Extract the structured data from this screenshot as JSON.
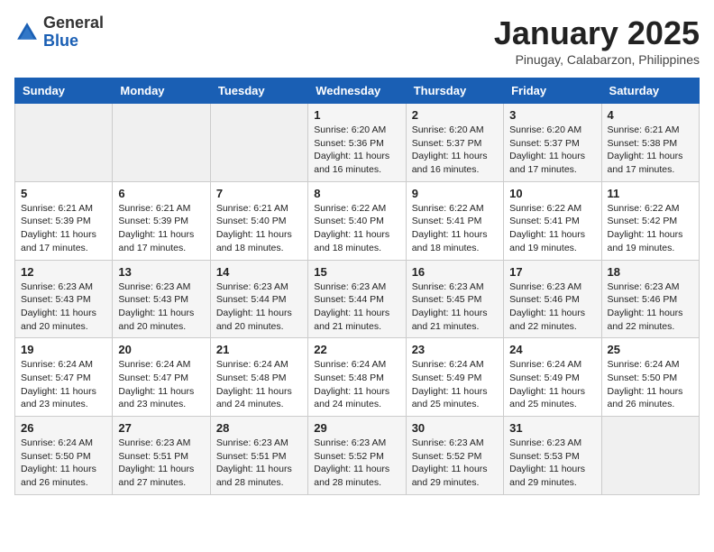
{
  "header": {
    "logo_general": "General",
    "logo_blue": "Blue",
    "month_title": "January 2025",
    "location": "Pinugay, Calabarzon, Philippines"
  },
  "weekdays": [
    "Sunday",
    "Monday",
    "Tuesday",
    "Wednesday",
    "Thursday",
    "Friday",
    "Saturday"
  ],
  "weeks": [
    [
      {
        "day": "",
        "sunrise": "",
        "sunset": "",
        "daylight": ""
      },
      {
        "day": "",
        "sunrise": "",
        "sunset": "",
        "daylight": ""
      },
      {
        "day": "",
        "sunrise": "",
        "sunset": "",
        "daylight": ""
      },
      {
        "day": "1",
        "sunrise": "Sunrise: 6:20 AM",
        "sunset": "Sunset: 5:36 PM",
        "daylight": "Daylight: 11 hours and 16 minutes."
      },
      {
        "day": "2",
        "sunrise": "Sunrise: 6:20 AM",
        "sunset": "Sunset: 5:37 PM",
        "daylight": "Daylight: 11 hours and 16 minutes."
      },
      {
        "day": "3",
        "sunrise": "Sunrise: 6:20 AM",
        "sunset": "Sunset: 5:37 PM",
        "daylight": "Daylight: 11 hours and 17 minutes."
      },
      {
        "day": "4",
        "sunrise": "Sunrise: 6:21 AM",
        "sunset": "Sunset: 5:38 PM",
        "daylight": "Daylight: 11 hours and 17 minutes."
      }
    ],
    [
      {
        "day": "5",
        "sunrise": "Sunrise: 6:21 AM",
        "sunset": "Sunset: 5:39 PM",
        "daylight": "Daylight: 11 hours and 17 minutes."
      },
      {
        "day": "6",
        "sunrise": "Sunrise: 6:21 AM",
        "sunset": "Sunset: 5:39 PM",
        "daylight": "Daylight: 11 hours and 17 minutes."
      },
      {
        "day": "7",
        "sunrise": "Sunrise: 6:21 AM",
        "sunset": "Sunset: 5:40 PM",
        "daylight": "Daylight: 11 hours and 18 minutes."
      },
      {
        "day": "8",
        "sunrise": "Sunrise: 6:22 AM",
        "sunset": "Sunset: 5:40 PM",
        "daylight": "Daylight: 11 hours and 18 minutes."
      },
      {
        "day": "9",
        "sunrise": "Sunrise: 6:22 AM",
        "sunset": "Sunset: 5:41 PM",
        "daylight": "Daylight: 11 hours and 18 minutes."
      },
      {
        "day": "10",
        "sunrise": "Sunrise: 6:22 AM",
        "sunset": "Sunset: 5:41 PM",
        "daylight": "Daylight: 11 hours and 19 minutes."
      },
      {
        "day": "11",
        "sunrise": "Sunrise: 6:22 AM",
        "sunset": "Sunset: 5:42 PM",
        "daylight": "Daylight: 11 hours and 19 minutes."
      }
    ],
    [
      {
        "day": "12",
        "sunrise": "Sunrise: 6:23 AM",
        "sunset": "Sunset: 5:43 PM",
        "daylight": "Daylight: 11 hours and 20 minutes."
      },
      {
        "day": "13",
        "sunrise": "Sunrise: 6:23 AM",
        "sunset": "Sunset: 5:43 PM",
        "daylight": "Daylight: 11 hours and 20 minutes."
      },
      {
        "day": "14",
        "sunrise": "Sunrise: 6:23 AM",
        "sunset": "Sunset: 5:44 PM",
        "daylight": "Daylight: 11 hours and 20 minutes."
      },
      {
        "day": "15",
        "sunrise": "Sunrise: 6:23 AM",
        "sunset": "Sunset: 5:44 PM",
        "daylight": "Daylight: 11 hours and 21 minutes."
      },
      {
        "day": "16",
        "sunrise": "Sunrise: 6:23 AM",
        "sunset": "Sunset: 5:45 PM",
        "daylight": "Daylight: 11 hours and 21 minutes."
      },
      {
        "day": "17",
        "sunrise": "Sunrise: 6:23 AM",
        "sunset": "Sunset: 5:46 PM",
        "daylight": "Daylight: 11 hours and 22 minutes."
      },
      {
        "day": "18",
        "sunrise": "Sunrise: 6:23 AM",
        "sunset": "Sunset: 5:46 PM",
        "daylight": "Daylight: 11 hours and 22 minutes."
      }
    ],
    [
      {
        "day": "19",
        "sunrise": "Sunrise: 6:24 AM",
        "sunset": "Sunset: 5:47 PM",
        "daylight": "Daylight: 11 hours and 23 minutes."
      },
      {
        "day": "20",
        "sunrise": "Sunrise: 6:24 AM",
        "sunset": "Sunset: 5:47 PM",
        "daylight": "Daylight: 11 hours and 23 minutes."
      },
      {
        "day": "21",
        "sunrise": "Sunrise: 6:24 AM",
        "sunset": "Sunset: 5:48 PM",
        "daylight": "Daylight: 11 hours and 24 minutes."
      },
      {
        "day": "22",
        "sunrise": "Sunrise: 6:24 AM",
        "sunset": "Sunset: 5:48 PM",
        "daylight": "Daylight: 11 hours and 24 minutes."
      },
      {
        "day": "23",
        "sunrise": "Sunrise: 6:24 AM",
        "sunset": "Sunset: 5:49 PM",
        "daylight": "Daylight: 11 hours and 25 minutes."
      },
      {
        "day": "24",
        "sunrise": "Sunrise: 6:24 AM",
        "sunset": "Sunset: 5:49 PM",
        "daylight": "Daylight: 11 hours and 25 minutes."
      },
      {
        "day": "25",
        "sunrise": "Sunrise: 6:24 AM",
        "sunset": "Sunset: 5:50 PM",
        "daylight": "Daylight: 11 hours and 26 minutes."
      }
    ],
    [
      {
        "day": "26",
        "sunrise": "Sunrise: 6:24 AM",
        "sunset": "Sunset: 5:50 PM",
        "daylight": "Daylight: 11 hours and 26 minutes."
      },
      {
        "day": "27",
        "sunrise": "Sunrise: 6:23 AM",
        "sunset": "Sunset: 5:51 PM",
        "daylight": "Daylight: 11 hours and 27 minutes."
      },
      {
        "day": "28",
        "sunrise": "Sunrise: 6:23 AM",
        "sunset": "Sunset: 5:51 PM",
        "daylight": "Daylight: 11 hours and 28 minutes."
      },
      {
        "day": "29",
        "sunrise": "Sunrise: 6:23 AM",
        "sunset": "Sunset: 5:52 PM",
        "daylight": "Daylight: 11 hours and 28 minutes."
      },
      {
        "day": "30",
        "sunrise": "Sunrise: 6:23 AM",
        "sunset": "Sunset: 5:52 PM",
        "daylight": "Daylight: 11 hours and 29 minutes."
      },
      {
        "day": "31",
        "sunrise": "Sunrise: 6:23 AM",
        "sunset": "Sunset: 5:53 PM",
        "daylight": "Daylight: 11 hours and 29 minutes."
      },
      {
        "day": "",
        "sunrise": "",
        "sunset": "",
        "daylight": ""
      }
    ]
  ]
}
